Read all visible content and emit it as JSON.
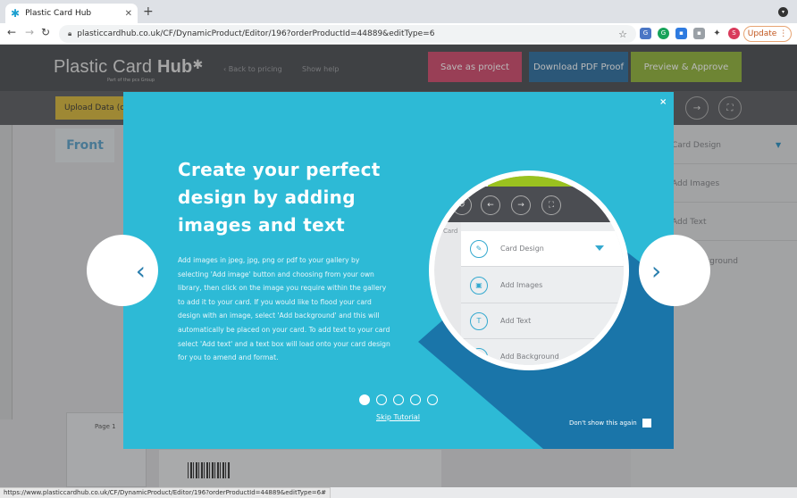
{
  "browser": {
    "tab_title": "Plastic Card Hub",
    "url": "plasticcardhub.co.uk/CF/DynamicProduct/Editor/196?orderProductId=44889&editType=6",
    "update_label": "Update",
    "status_url": "https://www.plasticcardhub.co.uk/CF/DynamicProduct/Editor/196?orderProductId=44889&editType=6#"
  },
  "header": {
    "logo_main": "Plastic Card ",
    "logo_hub": "Hub",
    "logo_sub": "Part of the pcs Group",
    "back_link": "Back to pricing",
    "help_link": "Show help",
    "save_label": "Save as project",
    "download_label": "Download PDF Proof",
    "preview_label": "Preview & Approve",
    "colors": {
      "save": "#cf4a6c",
      "download": "#2d6e9e",
      "preview": "#8fb23a"
    }
  },
  "toolbar": {
    "upload_label": "Upload Data (c"
  },
  "editor": {
    "front_tab": "Front",
    "page_label": "Page 1",
    "panel_items": [
      "Card Design",
      "Add Images",
      "Add Text",
      "Add Background"
    ]
  },
  "modal": {
    "title": "Create your perfect design by adding images and text",
    "body": "Add images in jpeg, jpg, png or pdf to your gallery by selecting 'Add image' button and choosing from your own library, then click on the image you require within the gallery to add it to your card. If you would like to flood your card design with an image, select 'Add background' and this will automatically be placed on your card. To add text to your card select 'Add text' and a text box will load onto your card design for you to amend and format.",
    "skip_label": "Skip Tutorial",
    "dont_show_label": "Don't show this again",
    "close_label": "×",
    "prev_label": "‹",
    "next_label": "›",
    "dots": 5,
    "active_dot": 0,
    "colors": {
      "bg": "#2dbad6",
      "shape": "#1a75a9",
      "accent": "#34a9cf"
    }
  },
  "magnifier": {
    "card_label": "Card",
    "items": [
      "Card Design",
      "Add Images",
      "Add Text",
      "Add Background"
    ]
  }
}
